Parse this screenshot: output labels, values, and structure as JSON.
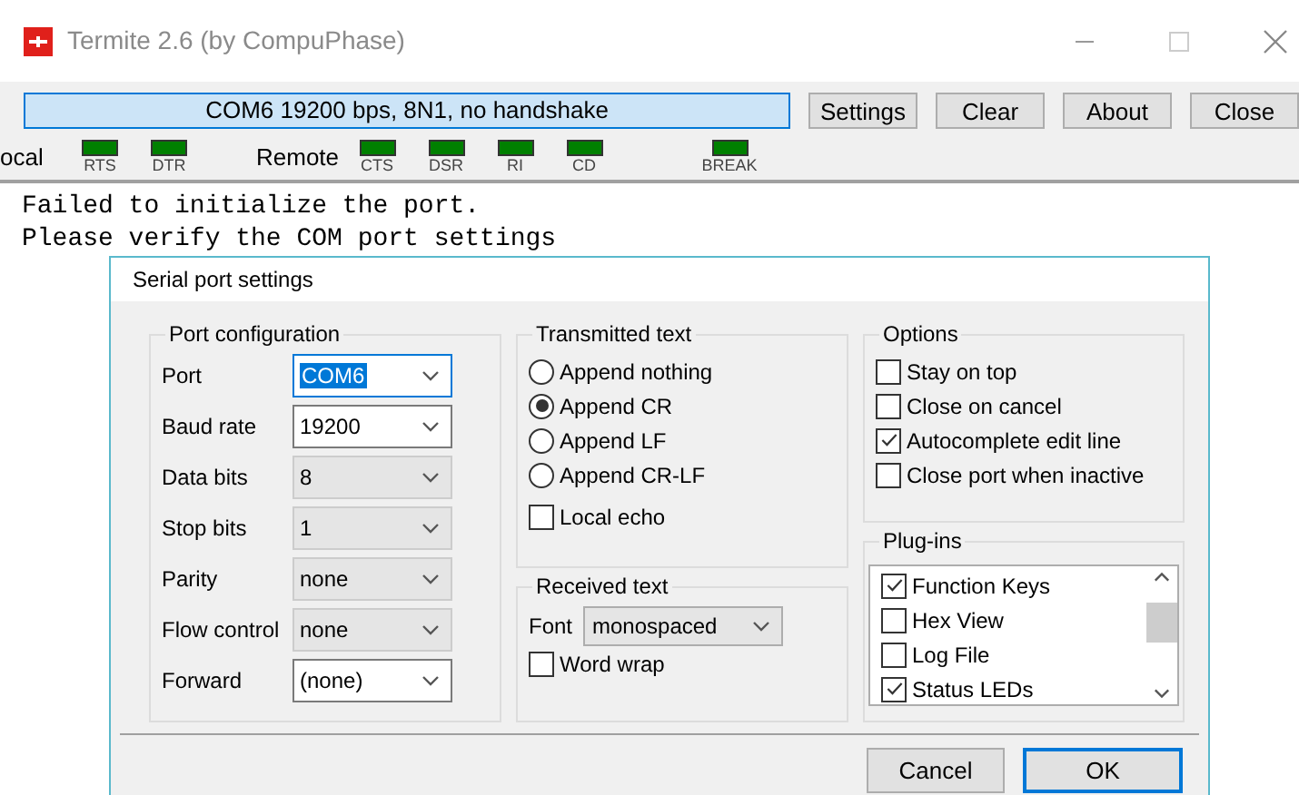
{
  "window": {
    "title": "Termite 2.6 (by CompuPhase)"
  },
  "toolbar": {
    "status": "COM6 19200 bps, 8N1, no handshake",
    "buttons": [
      "Settings",
      "Clear",
      "About",
      "Close"
    ]
  },
  "leds": {
    "local_label": "ocal",
    "local": [
      "RTS",
      "DTR"
    ],
    "remote_label": "Remote",
    "remote": [
      "CTS",
      "DSR",
      "RI",
      "CD"
    ],
    "break": "BREAK"
  },
  "terminal": {
    "lines": [
      "Failed to initialize the port.",
      "Please verify the COM port settings"
    ]
  },
  "dialog": {
    "title": "Serial port settings",
    "port_configuration": {
      "title": "Port configuration",
      "fields": [
        {
          "label": "Port",
          "value": "COM6",
          "disabled": false,
          "focused": true
        },
        {
          "label": "Baud rate",
          "value": "19200",
          "disabled": false,
          "focused": false
        },
        {
          "label": "Data bits",
          "value": "8",
          "disabled": true,
          "focused": false
        },
        {
          "label": "Stop bits",
          "value": "1",
          "disabled": true,
          "focused": false
        },
        {
          "label": "Parity",
          "value": "none",
          "disabled": true,
          "focused": false
        },
        {
          "label": "Flow control",
          "value": "none",
          "disabled": true,
          "focused": false
        },
        {
          "label": "Forward",
          "value": "(none)",
          "disabled": false,
          "focused": false
        }
      ]
    },
    "transmitted_text": {
      "title": "Transmitted text",
      "options": [
        {
          "label": "Append nothing",
          "selected": false
        },
        {
          "label": "Append CR",
          "selected": true
        },
        {
          "label": "Append LF",
          "selected": false
        },
        {
          "label": "Append CR-LF",
          "selected": false
        }
      ],
      "local_echo": {
        "label": "Local echo",
        "checked": false
      }
    },
    "received_text": {
      "title": "Received text",
      "font_label": "Font",
      "font": "monospaced",
      "word_wrap": {
        "label": "Word wrap",
        "checked": false
      }
    },
    "options": {
      "title": "Options",
      "items": [
        {
          "label": "Stay on top",
          "checked": false
        },
        {
          "label": "Close on cancel",
          "checked": false
        },
        {
          "label": "Autocomplete edit line",
          "checked": true
        },
        {
          "label": "Close port when inactive",
          "checked": false
        }
      ]
    },
    "plugins": {
      "title": "Plug-ins",
      "items": [
        {
          "label": "Function Keys",
          "checked": true
        },
        {
          "label": "Hex View",
          "checked": false
        },
        {
          "label": "Log File",
          "checked": false
        },
        {
          "label": "Status LEDs",
          "checked": true
        }
      ]
    },
    "buttons": [
      {
        "label": "Cancel",
        "default": false
      },
      {
        "label": "OK",
        "default": true
      }
    ]
  }
}
